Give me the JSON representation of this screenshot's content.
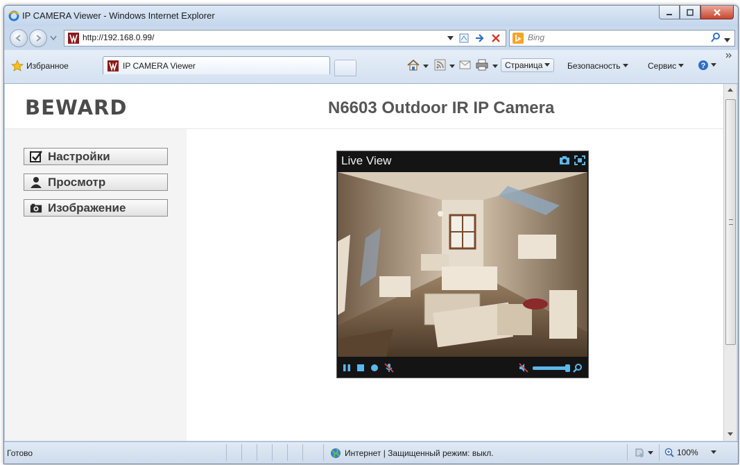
{
  "window": {
    "title": "IP CAMERA Viewer - Windows Internet Explorer"
  },
  "address_bar": {
    "url": "http://192.168.0.99/"
  },
  "search": {
    "placeholder": "Bing"
  },
  "favorites": {
    "label": "Избранное"
  },
  "tab": {
    "label": "IP CAMERA Viewer"
  },
  "command_bar": {
    "page_label": "Страница",
    "safety_label": "Безопасность",
    "service_label": "Сервис"
  },
  "page": {
    "logo": "BEWARD",
    "title": "N6603 Outdoor IR IP Camera"
  },
  "menu": {
    "settings": "Настройки",
    "view": "Просмотр",
    "image": "Изображение"
  },
  "viewer": {
    "title": "Live View"
  },
  "status": {
    "text": "Готово",
    "zone": "Интернет | Защищенный режим: выкл.",
    "zoom": "100%"
  },
  "colors": {
    "accent": "#5db7ea",
    "viewer_bg": "#141414"
  }
}
